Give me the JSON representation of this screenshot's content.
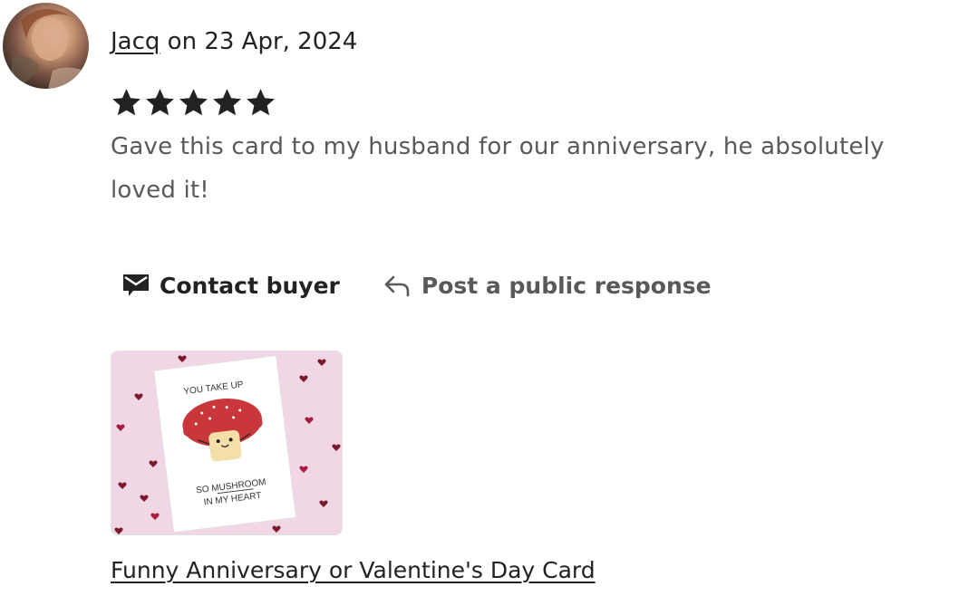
{
  "review": {
    "reviewer_name": "Jacq",
    "date_text": " on 23 Apr, 2024",
    "rating": 5,
    "rating_max": 5,
    "text": "Gave this card to my husband for our anniversary, he absolutely loved it!"
  },
  "actions": {
    "contact_label": "Contact buyer",
    "contact_icon": "envelope-icon",
    "respond_label": "Post a public response",
    "respond_icon": "reply-arrow-icon"
  },
  "product": {
    "title": "Funny Anniversary or Valentine's Day Card",
    "card_line1": "YOU TAKE UP",
    "card_line2": "SO MUSHROOM",
    "card_line3": "IN MY HEART"
  },
  "colors": {
    "text_dark": "#222222",
    "text_muted": "#595959",
    "thumb_background": "#f1d7e6",
    "mushroom_cap": "#c9373b",
    "heart": "#7a1a2c"
  }
}
